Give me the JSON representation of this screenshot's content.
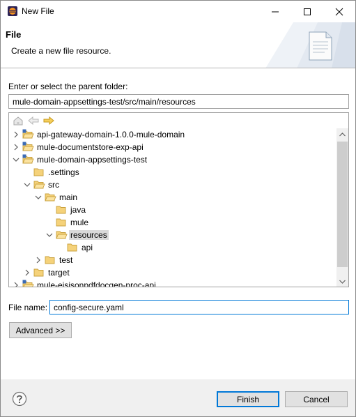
{
  "window": {
    "title": "New File",
    "minimize_icon": "minimize-icon",
    "maximize_icon": "maximize-icon",
    "close_icon": "close-icon"
  },
  "banner": {
    "title": "File",
    "description": "Create a new file resource."
  },
  "parent_folder": {
    "label": "Enter or select the parent folder:",
    "value": "mule-domain-appsettings-test/src/main/resources"
  },
  "tree": {
    "toolbar_icons": [
      "home-icon",
      "back-arrow-icon",
      "forward-arrow-icon"
    ],
    "items": [
      {
        "label": "api-gateway-domain-1.0.0-mule-domain",
        "type": "project",
        "expanded": false,
        "depth": 0
      },
      {
        "label": "mule-documentstore-exp-api",
        "type": "project",
        "expanded": false,
        "depth": 0
      },
      {
        "label": "mule-domain-appsettings-test",
        "type": "project",
        "expanded": true,
        "depth": 0
      },
      {
        "label": ".settings",
        "type": "folder",
        "expanded": null,
        "depth": 1
      },
      {
        "label": "src",
        "type": "folder",
        "expanded": true,
        "depth": 1
      },
      {
        "label": "main",
        "type": "folder",
        "expanded": true,
        "depth": 2
      },
      {
        "label": "java",
        "type": "folder",
        "expanded": null,
        "depth": 3
      },
      {
        "label": "mule",
        "type": "folder",
        "expanded": null,
        "depth": 3
      },
      {
        "label": "resources",
        "type": "folder",
        "expanded": true,
        "depth": 3,
        "selected": true
      },
      {
        "label": "api",
        "type": "folder",
        "expanded": null,
        "depth": 4
      },
      {
        "label": "test",
        "type": "folder",
        "expanded": false,
        "depth": 2
      },
      {
        "label": "target",
        "type": "folder",
        "expanded": false,
        "depth": 1
      },
      {
        "label": "mule-eisisonpdfdocgen-proc-api",
        "type": "project",
        "expanded": false,
        "depth": 0
      }
    ]
  },
  "file_name": {
    "label": "File name:",
    "value": "config-secure.yaml"
  },
  "buttons": {
    "advanced": "Advanced >>",
    "finish": "Finish",
    "cancel": "Cancel"
  },
  "colors": {
    "folder_fill": "#f5d27a",
    "folder_stroke": "#c9a03c",
    "selection": "#d9d9d9",
    "focus_border": "#0078d7",
    "footer_bg": "#f0f0f0"
  }
}
